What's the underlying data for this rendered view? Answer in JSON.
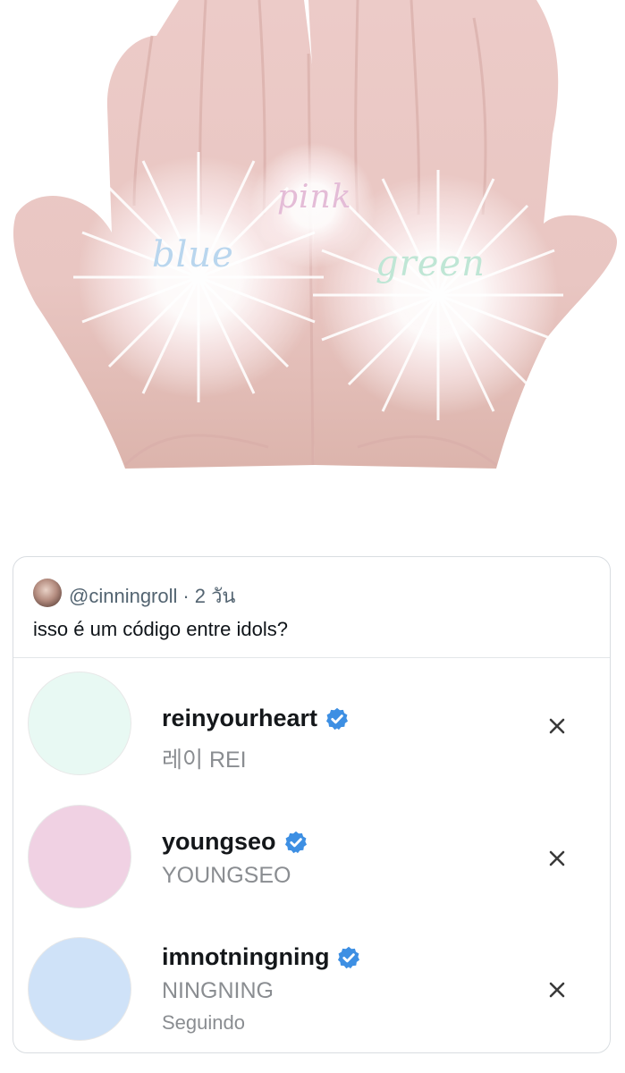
{
  "hero": {
    "words": {
      "left": "blue",
      "center": "pink",
      "right": "green"
    }
  },
  "tweet": {
    "handle": "@cinningroll",
    "separator": "·",
    "time": "2 วัน",
    "text": "isso é um código entre idols?",
    "accounts": [
      {
        "handle": "reinyourheart",
        "display_name": "레이 REI",
        "status": "",
        "avatar_color": "#e8f9f3"
      },
      {
        "handle": "youngseo",
        "display_name": "YOUNGSEO",
        "status": "",
        "avatar_color": "#f0d1e3"
      },
      {
        "handle": "imnotningning",
        "display_name": "NINGNING",
        "status": "Seguindo",
        "avatar_color": "#cfe2f8"
      }
    ]
  },
  "colors": {
    "verified_badge": "#3d8fe3",
    "secondary_text": "#8a8d91"
  },
  "icons": {
    "verified": "verified-badge-icon",
    "dismiss": "close-icon"
  }
}
